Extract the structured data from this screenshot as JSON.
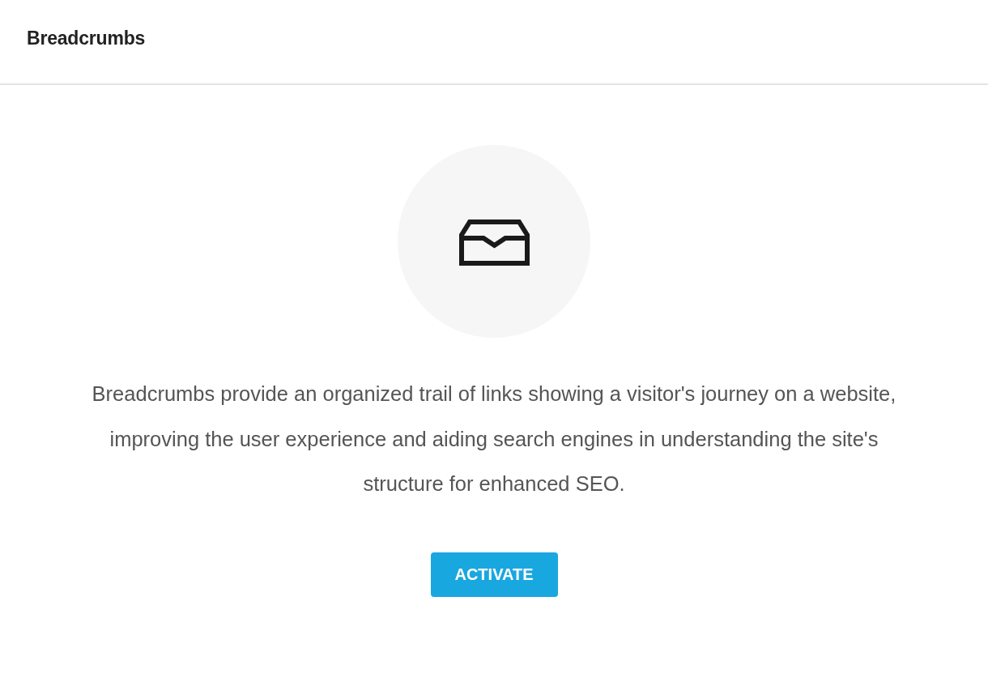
{
  "header": {
    "title": "Breadcrumbs"
  },
  "empty_state": {
    "description": "Breadcrumbs provide an organized trail of links showing a visitor's journey on a website, improving the user experience and aiding search engines in understanding the site's structure for enhanced SEO.",
    "button": {
      "label": "ACTIVATE"
    }
  }
}
